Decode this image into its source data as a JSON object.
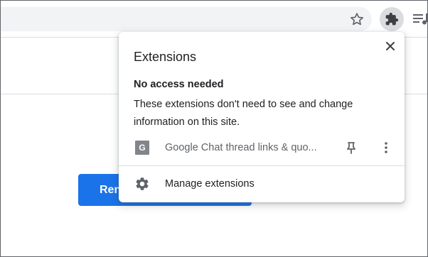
{
  "toolbar": {
    "icons": [
      "star-icon",
      "puzzle-icon",
      "media-queue-icon"
    ]
  },
  "page": {
    "button_label": "Ren"
  },
  "popup": {
    "title": "Extensions",
    "section_heading": "No access needed",
    "section_description": "These extensions don't need to see and change information on this site.",
    "extension": {
      "icon_letter": "G",
      "name": "Google Chat thread links & quo..."
    },
    "manage_label": "Manage extensions"
  },
  "colors": {
    "accent": "#1a73e8",
    "omnibox": "#f1f3f4",
    "icon_gray": "#5f6368"
  }
}
